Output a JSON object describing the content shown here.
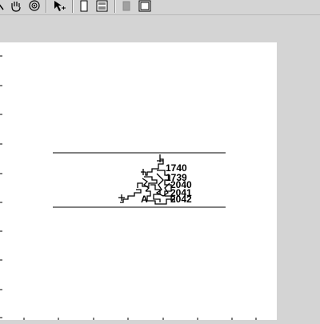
{
  "toolbar": {
    "tools": [
      {
        "name": "zoom-tool-icon"
      },
      {
        "name": "hand-pan-icon"
      },
      {
        "name": "rotate-3d-icon"
      },
      {
        "name": "select-cursor-icon"
      },
      {
        "name": "page-single-icon"
      },
      {
        "name": "page-layout-icon"
      },
      {
        "name": "gray-square-icon"
      },
      {
        "name": "frame-window-icon"
      }
    ]
  },
  "plot": {
    "labels": {
      "l1740": "1740",
      "l1739": "1739",
      "l2040": "2040",
      "l2041": "2041",
      "l2042": "2042",
      "la": "A"
    }
  },
  "colors": {
    "background": "#d4d4d4",
    "canvas": "#ffffff",
    "ink": "#000000"
  }
}
